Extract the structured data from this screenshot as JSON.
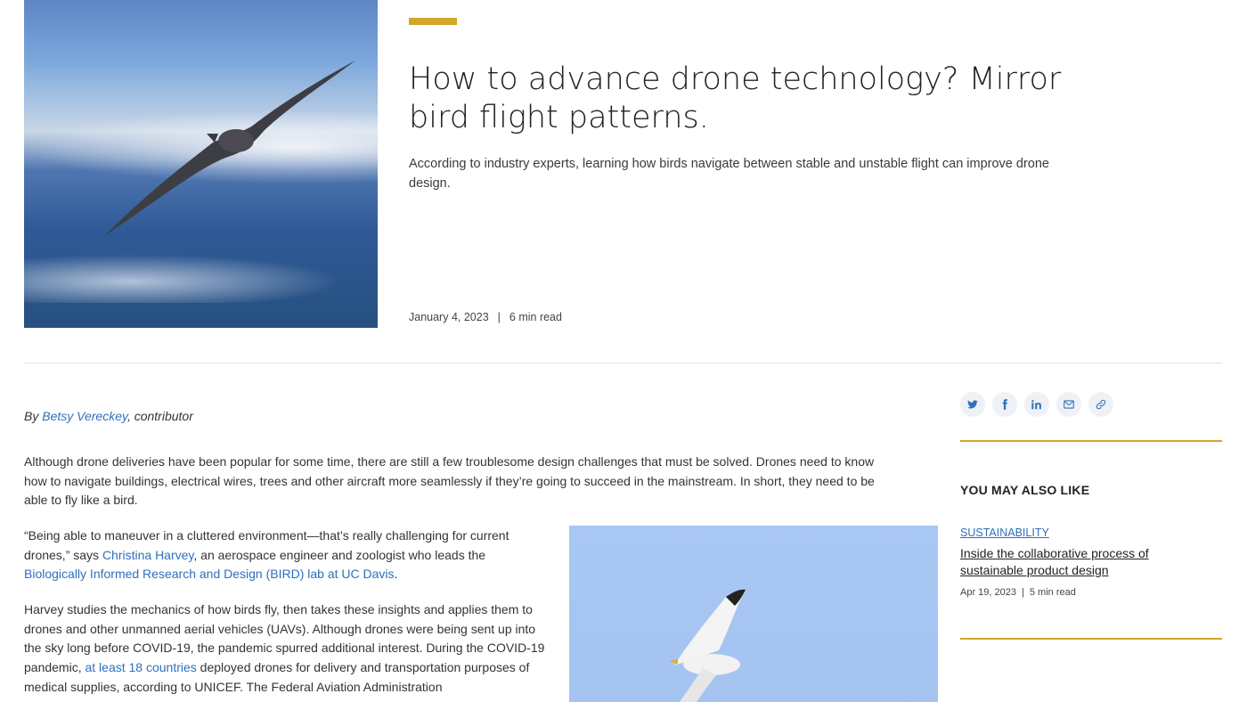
{
  "hero": {
    "image_alt": "Bird soaring over blue mountains",
    "title": "How to advance drone technology? Mirror bird flight patterns.",
    "dek": "According to industry experts, learning how birds navigate between stable and unstable flight can improve drone design.",
    "date": "January 4, 2023",
    "separator": "|",
    "read_time": "6 min read"
  },
  "byline": {
    "prefix": "By ",
    "author": "Betsy Vereckey",
    "suffix": ", contributor"
  },
  "body": {
    "p1": "Although drone deliveries have been popular for some time, there are still a few troublesome design challenges that must be solved. Drones need to know how to navigate buildings, electrical wires, trees and other aircraft more seamlessly if they’re going to succeed in the mainstream. In short, they need to be able to fly like a bird.",
    "p2_a": "“Being able to maneuver in a cluttered environment—that’s really challenging for current drones,” says ",
    "p2_link1": "Christina Harvey",
    "p2_b": ", an aerospace engineer and zoologist who leads the ",
    "p2_link2": "Biologically Informed Research and Design (BIRD) lab at UC Davis",
    "p2_c": ".",
    "p3_a": "Harvey studies the mechanics of how birds fly, then takes these insights and applies them to drones and other unmanned aerial vehicles (UAVs). Although drones were being sent up into the sky long before COVID-19, the pandemic spurred additional interest. During the COVID-19 pandemic, ",
    "p3_link1": "at least 18 countries",
    "p3_b": " deployed drones for delivery and transportation purposes of medical supplies, according to UNICEF. The Federal Aviation Administration",
    "inline_image_alt": "Gull flying against a blue sky"
  },
  "share": {
    "icons": [
      "twitter-icon",
      "facebook-icon",
      "linkedin-icon",
      "email-icon",
      "link-icon"
    ]
  },
  "sidebar": {
    "heading": "YOU MAY ALSO LIKE",
    "item": {
      "category": "SUSTAINABILITY",
      "title": "Inside the collaborative process of sustainable product design",
      "date": "Apr 19, 2023",
      "separator": "|",
      "read_time": "5 min read"
    }
  },
  "colors": {
    "accent": "#d4a52b",
    "link": "#2f6fbb",
    "text": "#333333"
  }
}
